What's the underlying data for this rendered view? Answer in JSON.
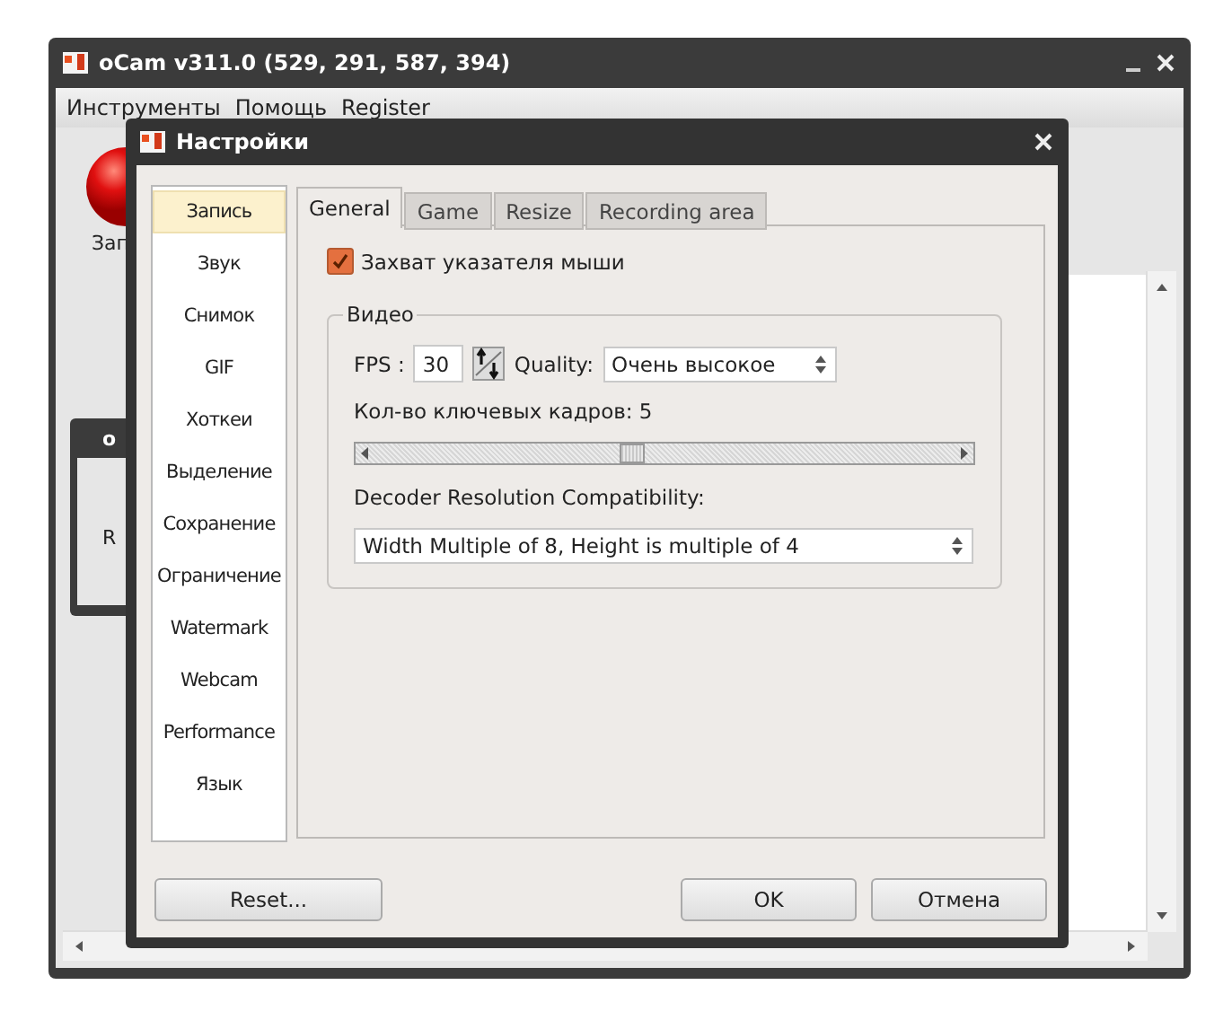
{
  "main_window": {
    "title": "oCam v311.0 (529, 291, 587, 394)",
    "menu": [
      "Инструменты",
      "Помощь",
      "Register"
    ],
    "record_label": "Зап",
    "mini_window": {
      "title": "o",
      "label": "R"
    }
  },
  "dialog": {
    "title": "Настройки",
    "sidebar": [
      {
        "label": "Запись",
        "selected": true
      },
      {
        "label": "Звук",
        "selected": false
      },
      {
        "label": "Снимок",
        "selected": false
      },
      {
        "label": "GIF",
        "selected": false
      },
      {
        "label": "Хоткеи",
        "selected": false
      },
      {
        "label": "Выделение",
        "selected": false
      },
      {
        "label": "Сохранение",
        "selected": false
      },
      {
        "label": "Ограничение",
        "selected": false
      },
      {
        "label": "Watermark",
        "selected": false
      },
      {
        "label": "Webcam",
        "selected": false
      },
      {
        "label": "Performance",
        "selected": false
      },
      {
        "label": "Язык",
        "selected": false
      }
    ],
    "tabs": [
      {
        "label": "General",
        "selected": true
      },
      {
        "label": "Game",
        "selected": false
      },
      {
        "label": "Resize",
        "selected": false
      },
      {
        "label": "Recording area",
        "selected": false
      }
    ],
    "capture_cursor": {
      "label": "Захват указателя мыши",
      "checked": true
    },
    "video_group": {
      "title": "Видео",
      "fps_label": "FPS :",
      "fps_value": "30",
      "quality_label": "Quality:",
      "quality_value": "Очень высокое",
      "keyframes_label": "Кол-во ключевых кадров: 5",
      "keyframes_slider": {
        "level": 0.44
      },
      "decoder_label": "Decoder Resolution Compatibility:",
      "decoder_value": "Width Multiple of 8, Height is multiple of 4"
    },
    "buttons": {
      "reset": "Reset...",
      "ok": "OK",
      "cancel": "Отмена"
    }
  }
}
